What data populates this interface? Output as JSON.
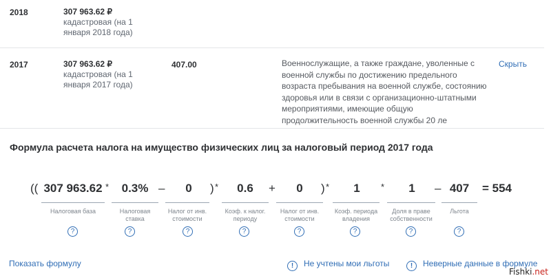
{
  "rows": [
    {
      "year": "2018",
      "value": "307 963.62 ₽",
      "value_note": "кадастровая (на 1 января 2018 года)"
    },
    {
      "year": "2017",
      "value": "307 963.62 ₽",
      "value_note": "кадастровая (на 1 января 2017 года)",
      "amount": "407.00",
      "description": "Военнослужащие, а также граждане, уволенные с военной службы по достижению предельного возраста пребывания на военной службе, состоянию здоровья или в связи с организационно-штатными мероприятиями, имеющие общую продолжительность военной службы 20 ле",
      "hide_label": "Скрыть"
    }
  ],
  "formula": {
    "title": "Формула расчета налога на имущество физических лиц за налоговый период 2017 года",
    "open_parens": "((",
    "close_paren": ")",
    "ops": [
      "*",
      "–",
      "*",
      "+",
      "*",
      "*",
      "–"
    ],
    "result": "= 554",
    "terms": [
      {
        "value": "307 963.62",
        "caption": "Налоговая база"
      },
      {
        "value": "0.3%",
        "caption": "Налоговая ставка"
      },
      {
        "value": "0",
        "caption": "Налог от инв. стоимости"
      },
      {
        "value": "0.6",
        "caption": "Коэф. к налог. периоду"
      },
      {
        "value": "0",
        "caption": "Налог от инв. стоимости"
      },
      {
        "value": "1",
        "caption": "Коэф. периода владения"
      },
      {
        "value": "1",
        "caption": "Доля в праве собственности"
      },
      {
        "value": "407",
        "caption": "Льгота"
      }
    ],
    "help_glyph": "?"
  },
  "footer": {
    "show_formula": "Показать формулу",
    "benefits_not_counted": "Не учтены мои льготы",
    "wrong_data": "Неверные данные в формуле",
    "info_glyph": "!"
  },
  "watermark": {
    "name": "Fishki",
    "tld": ".net"
  },
  "colors": {
    "link": "#2f6db5",
    "text": "#2e3033",
    "caption": "#7e858d",
    "separator": "#e3e5e8"
  }
}
